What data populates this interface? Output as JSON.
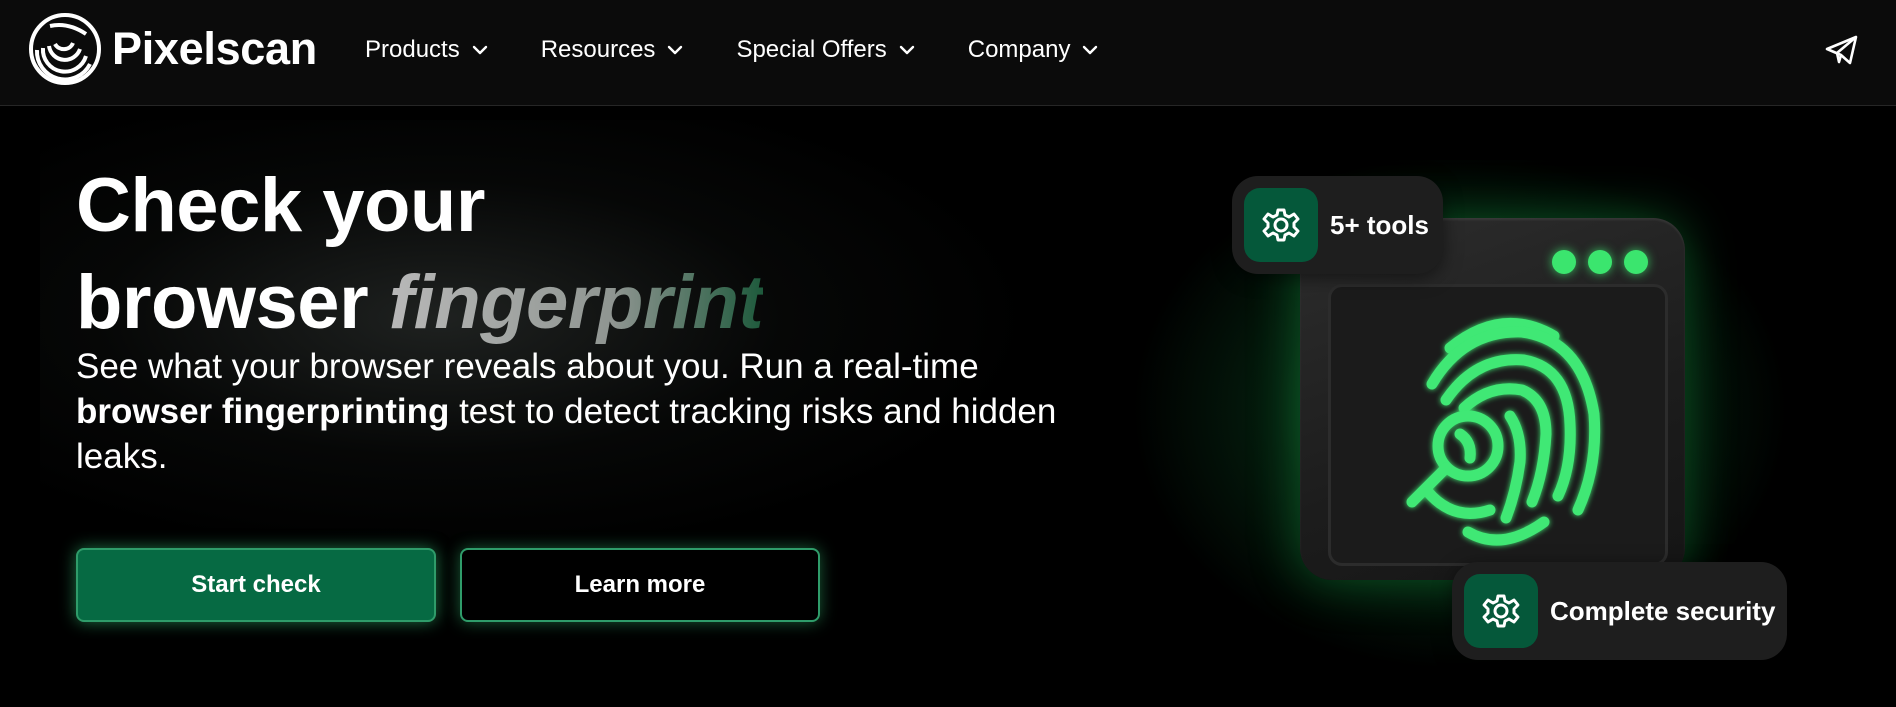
{
  "brand": {
    "name": "Pixelscan",
    "accent_color": "#066a43",
    "glow_color": "#37cd7d"
  },
  "nav": {
    "items": [
      {
        "label": "Products"
      },
      {
        "label": "Resources"
      },
      {
        "label": "Special Offers"
      },
      {
        "label": "Company"
      }
    ],
    "telegram_icon": "paper-plane-icon"
  },
  "hero": {
    "headline_line1": "Check your",
    "headline_word": "browser",
    "headline_accent": "fingerprint",
    "desc_part1": "See what your browser reveals about you. Run a real-time ",
    "desc_bold": "browser fingerprinting",
    "desc_part2": " test to detect tracking risks and hidden leaks.",
    "primary_button": "Start check",
    "secondary_button": "Learn more"
  },
  "illustration": {
    "badge_tools": "5+ tools",
    "badge_security": "Complete security",
    "badge_icon": "gear-icon",
    "main_icon": "fingerprint-magnifier-icon"
  }
}
